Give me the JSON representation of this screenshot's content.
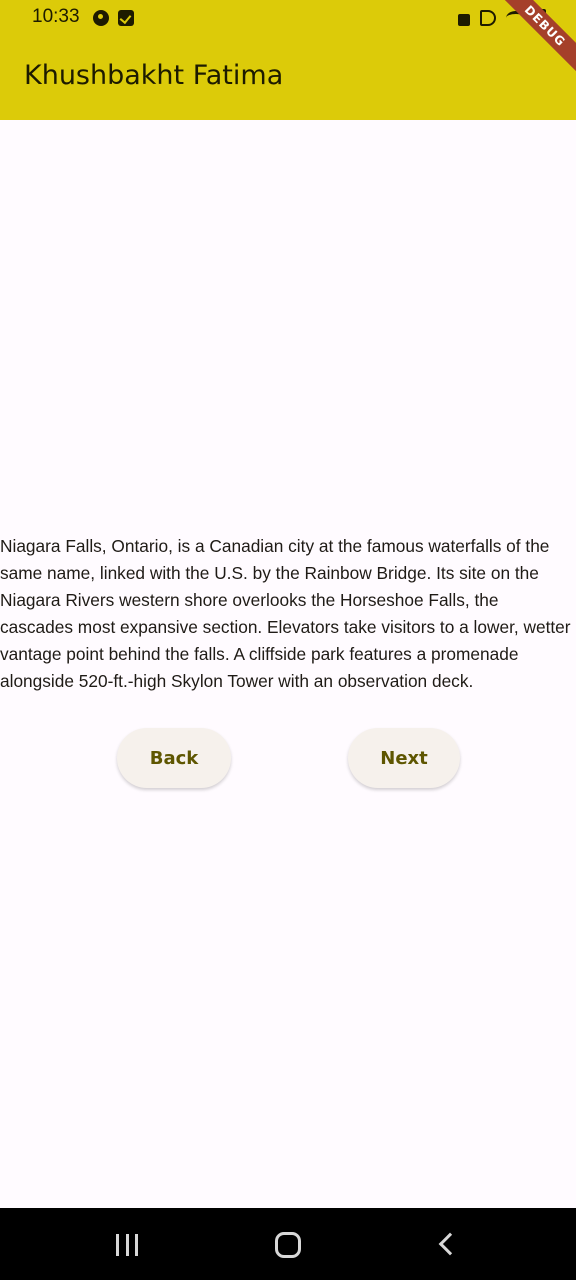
{
  "status_bar": {
    "time": "10:33",
    "left_icons": [
      "play-store-icon",
      "checklist-icon"
    ],
    "right_icons": [
      "lock-icon",
      "mute-icon",
      "wifi-icon",
      "battery-icon"
    ]
  },
  "debug_banner": "DEBUG",
  "app_bar": {
    "title": "Khushbakht Fatima",
    "background_color": "#dccb09"
  },
  "content": {
    "paragraph": "Niagara Falls, Ontario, is a Canadian city at the famous waterfalls of the same name, linked with the U.S. by the Rainbow Bridge. Its site on the Niagara Rivers western shore overlooks the Horseshoe Falls, the cascades most expansive section. Elevators take visitors to a lower, wetter vantage point behind the falls. A cliffside park features a promenade alongside 520-ft.-high Skylon Tower with an observation deck."
  },
  "buttons": {
    "back_label": "Back",
    "next_label": "Next"
  },
  "nav_bar": {
    "icons": [
      "recents-icon",
      "home-icon",
      "back-icon"
    ]
  }
}
